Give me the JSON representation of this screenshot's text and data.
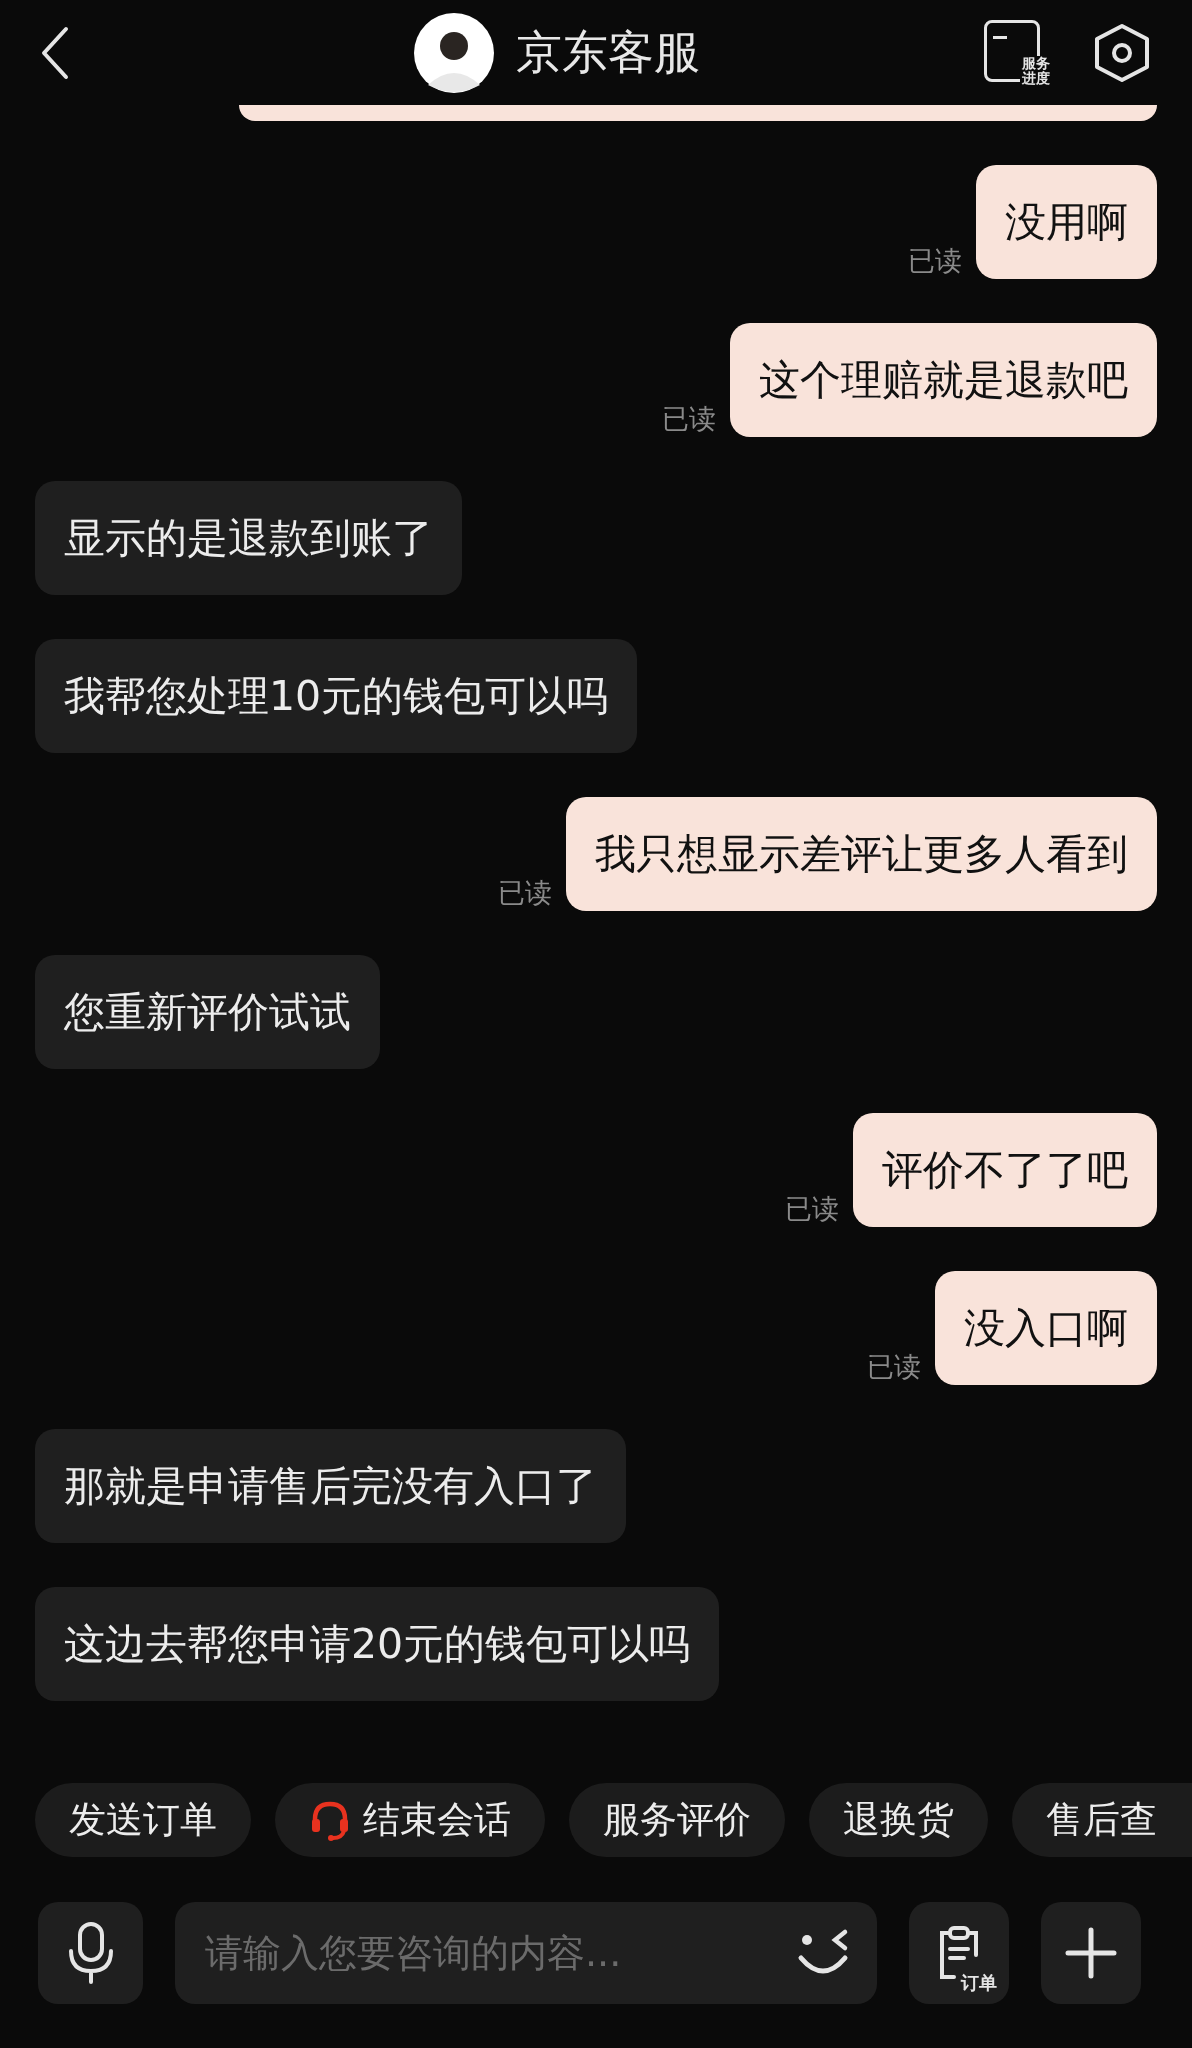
{
  "header": {
    "title": "京东客服",
    "progress_label": [
      "服务",
      "进度"
    ]
  },
  "messages": [
    {
      "kind": "sent",
      "text": "没用啊",
      "receipt": "已读"
    },
    {
      "kind": "sent",
      "text": "这个理赔就是退款吧",
      "receipt": "已读"
    },
    {
      "kind": "received",
      "text": "显示的是退款到账了"
    },
    {
      "kind": "received",
      "text": "我帮您处理10元的钱包可以吗"
    },
    {
      "kind": "sent",
      "text": "我只想显示差评让更多人看到",
      "receipt": "已读"
    },
    {
      "kind": "received",
      "text": "您重新评价试试"
    },
    {
      "kind": "sent",
      "text": "评价不了了吧",
      "receipt": "已读"
    },
    {
      "kind": "sent",
      "text": "没入口啊",
      "receipt": "已读"
    },
    {
      "kind": "received",
      "text": "那就是申请售后完没有入口了"
    },
    {
      "kind": "received",
      "text": "这边去帮您申请20元的钱包可以吗"
    }
  ],
  "quick_actions": [
    {
      "label": "发送订单",
      "kind": "plain"
    },
    {
      "label": "结束会话",
      "kind": "headset"
    },
    {
      "label": "服务评价",
      "kind": "plain"
    },
    {
      "label": "退换货",
      "kind": "plain"
    },
    {
      "label": "售后查",
      "kind": "plain"
    }
  ],
  "composer": {
    "placeholder": "请输入您要咨询的内容...",
    "order_label": "订单"
  }
}
